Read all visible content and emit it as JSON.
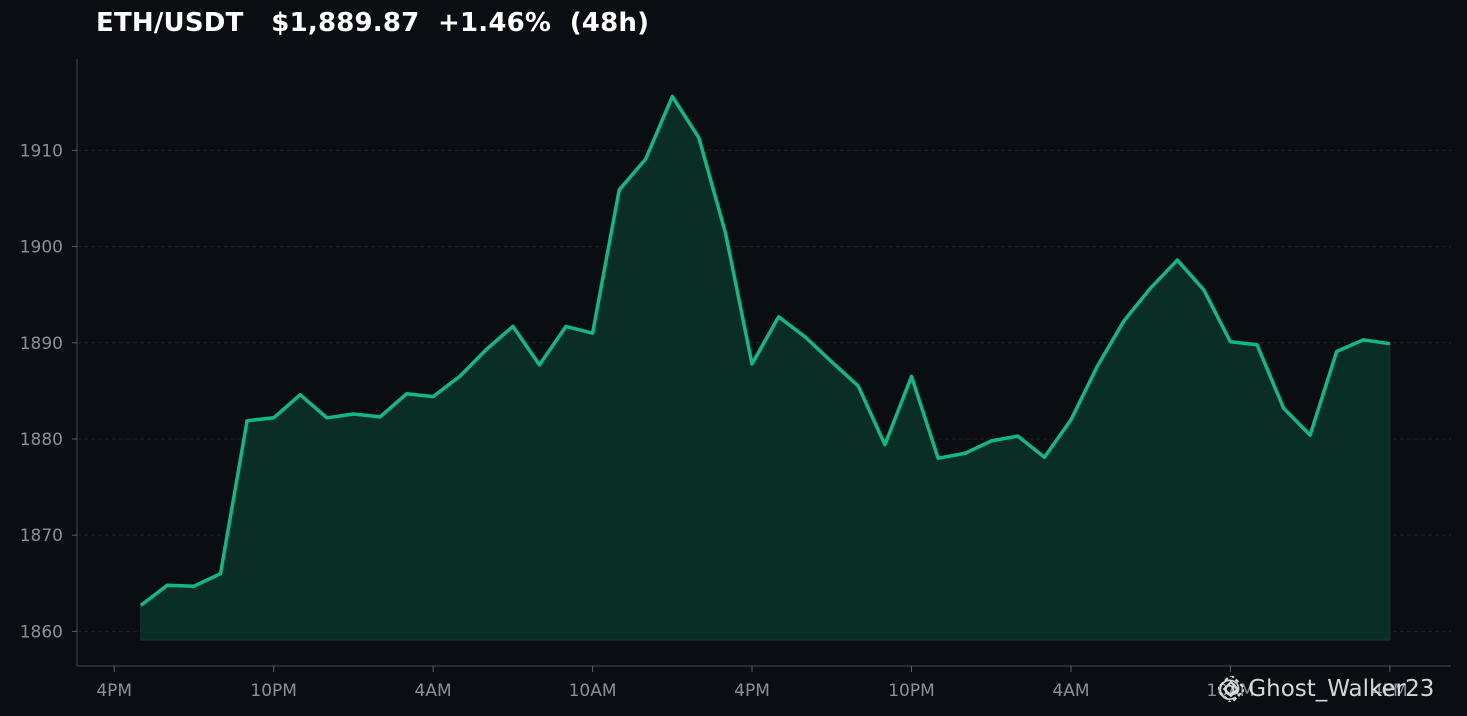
{
  "header": {
    "pair": "ETH/USDT",
    "price": "$1,889.87",
    "change": "+1.46%",
    "period": "(48h)"
  },
  "watermark": {
    "handle": "@ Ghost_Walker23",
    "icon": "binance-logo-icon"
  },
  "colors": {
    "background": "#0a0e12",
    "line": "#10b981",
    "fill": "#0a2e26",
    "axis_text": "#8a8f98",
    "grid": "#1e2328"
  },
  "chart_data": {
    "type": "area",
    "x": [
      0,
      1,
      2,
      3,
      4,
      5,
      6,
      7,
      8,
      9,
      10,
      11,
      12,
      13,
      14,
      15,
      16,
      17,
      18,
      19,
      20,
      21,
      22,
      23,
      24,
      25,
      26,
      27,
      28,
      29,
      30,
      31,
      32,
      33,
      34,
      35,
      36,
      37,
      38,
      39,
      40,
      41,
      42,
      43,
      44,
      45,
      46,
      47
    ],
    "y": [
      1862.7,
      1864.8,
      1864.7,
      1866.0,
      1881.9,
      1882.2,
      1884.6,
      1882.2,
      1882.6,
      1882.3,
      1884.7,
      1884.4,
      1886.5,
      1889.3,
      1891.7,
      1887.7,
      1891.7,
      1891.0,
      1905.9,
      1909.1,
      1915.6,
      1911.3,
      1901.4,
      1887.8,
      1892.7,
      1890.6,
      1888.0,
      1885.5,
      1879.4,
      1886.5,
      1878.0,
      1878.5,
      1879.8,
      1880.3,
      1878.1,
      1882.0,
      1887.6,
      1892.3,
      1895.7,
      1898.6,
      1895.5,
      1890.1,
      1889.8,
      1883.2,
      1880.4,
      1889.1,
      1890.3,
      1889.9
    ],
    "x_ticks": [
      -1,
      5,
      11,
      17,
      23,
      29,
      35,
      41,
      47
    ],
    "x_tick_labels": [
      "4PM",
      "10PM",
      "4AM",
      "10AM",
      "4PM",
      "10PM",
      "4AM",
      "10AM",
      "4PM"
    ],
    "y_ticks": [
      1860,
      1870,
      1880,
      1890,
      1900,
      1910
    ],
    "y_tick_labels": [
      "1860",
      "1870",
      "1880",
      "1890",
      "1900",
      "1910"
    ],
    "xlim": [
      -2.4,
      49.3
    ],
    "ylim": [
      1856.4,
      1919.5
    ],
    "fill_base": 1859.1,
    "grid": "horizontal-dashed",
    "legend": "none"
  }
}
